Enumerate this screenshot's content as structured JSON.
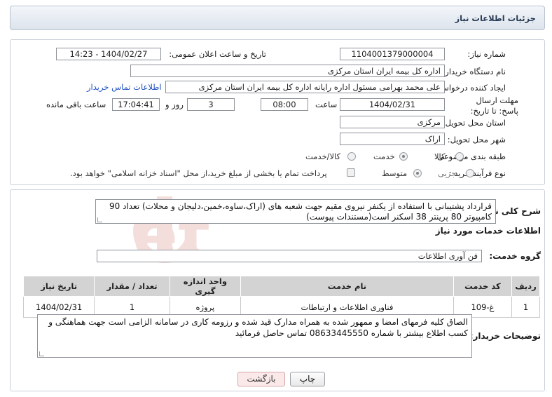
{
  "header": {
    "title": "جزئیات اطلاعات نیاز"
  },
  "form": {
    "need_number": {
      "label": "شماره نیاز:",
      "value": "1104001379000004"
    },
    "announce": {
      "label": "تاریخ و ساعت اعلان عمومی:",
      "value": "1404/02/27 - 14:23"
    },
    "buyer_org": {
      "label": "نام دستگاه خریدار:",
      "value": "اداره کل بیمه ایران استان مرکزی"
    },
    "requester": {
      "label": "ایجاد کننده درخواست:",
      "value": "علی محمد بهرامی مسئول اداره رایانه اداره کل بیمه ایران استان مرکزی",
      "contact_link": "اطلاعات تماس خریدار"
    },
    "deadline": {
      "label": "مهلت ارسال پاسخ: تا تاریخ:",
      "date": "1404/02/31",
      "time_label": "ساعت",
      "time": "08:00",
      "days": "3",
      "days_label": "روز و",
      "remaining": "17:04:41",
      "remaining_label": "ساعت باقی مانده"
    },
    "province": {
      "label": "استان محل تحویل:",
      "value": "مرکزی"
    },
    "city": {
      "label": "شهر محل تحویل:",
      "value": "اراک"
    },
    "category": {
      "label": "طبقه بندی موضوعی:",
      "options": [
        "کالا",
        "خدمت",
        "کالا/خدمت"
      ],
      "selected": "خدمت"
    },
    "process": {
      "label": "نوع فرآیند خرید :",
      "options": [
        "جزیی",
        "متوسط"
      ],
      "selected": "متوسط",
      "payment_note": "پرداخت تمام یا بخشی از مبلغ خرید،از محل \"اسناد خزانه اسلامی\" خواهد بود."
    }
  },
  "summary": {
    "label": "شرح کلی نیاز:",
    "text": "قرارداد پشتیبانی با استفاده از یکنفر نیروی مقیم جهت شعبه های (اراک،ساوه،خمین،دلیجان و محلات) تعداد 90 کامپیوتر 80 پرینتر 38 اسکنر است(مستندات پیوست)"
  },
  "services": {
    "section_title": "اطلاعات خدمات مورد نیاز",
    "group_label": "گروه خدمت:",
    "group_value": "فن آوری اطلاعات",
    "columns": [
      "ردیف",
      "کد خدمت",
      "نام خدمت",
      "واحد اندازه گیری",
      "تعداد / مقدار",
      "تاریخ نیاز"
    ],
    "rows": [
      [
        "1",
        "غ-109",
        "فناوری اطلاعات و ارتباطات",
        "پروژه",
        "1",
        "1404/02/31"
      ]
    ]
  },
  "buyer_notes": {
    "label": "توضیحات خریدار:",
    "text": "الصاق کلیه فرمهای امضا و ممهور شده به همراه مدارک قید شده و رزومه کاری در سامانه الزامی است جهت هماهنگی و کسب اطلاع بیشتر با شماره 08633445550 تماس حاصل فرمائید"
  },
  "actions": {
    "print": "چاپ",
    "back": "بازگشت"
  },
  "watermark": {
    "text": "AriaTender.net"
  },
  "colors": {
    "link": "#1f4fbf",
    "header_bg": "#dde4ec",
    "table_header": "#d3d3d3",
    "back_button": "#fbe9ea"
  }
}
